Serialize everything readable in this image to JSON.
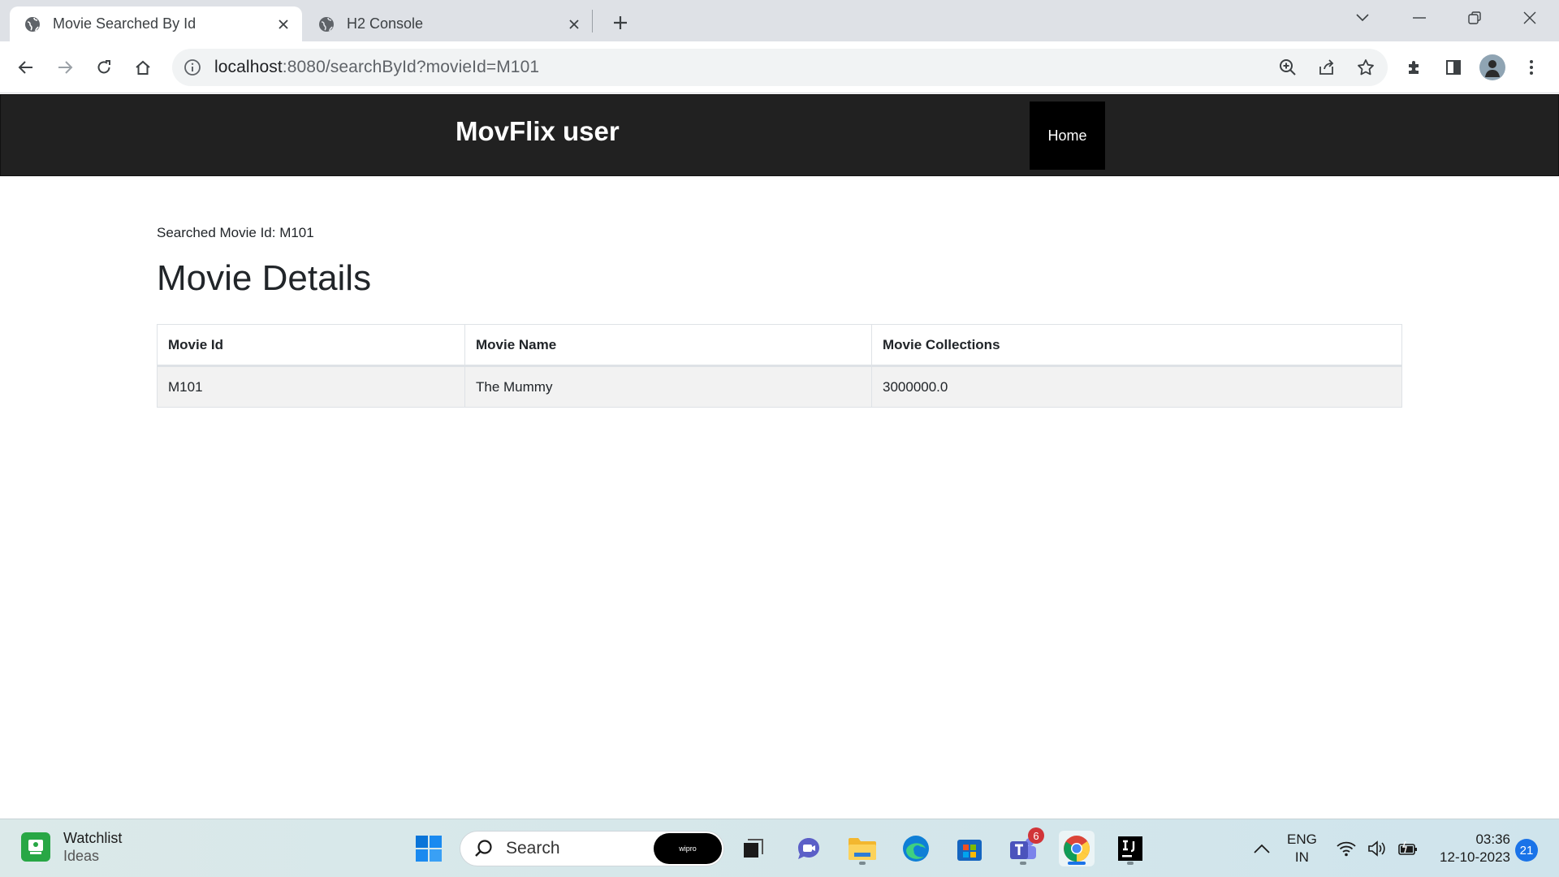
{
  "browser": {
    "tabs": [
      {
        "title": "Movie Searched By Id",
        "active": true
      },
      {
        "title": "H2 Console",
        "active": false
      }
    ],
    "url_host": "localhost",
    "url_rest": ":8080/searchById?movieId=M101"
  },
  "page": {
    "brand": "MovFlix user",
    "nav_home": "Home",
    "searched_label": "Searched Movie Id: M101",
    "heading": "Movie Details",
    "table": {
      "headers": [
        "Movie Id",
        "Movie Name",
        "Movie Collections"
      ],
      "rows": [
        [
          "M101",
          "The Mummy",
          "3000000.0"
        ]
      ]
    }
  },
  "taskbar": {
    "widget_title": "Watchlist",
    "widget_subtitle": "Ideas",
    "search_placeholder": "Search",
    "wipro_label": "wipro",
    "teams_badge": "6",
    "lang_top": "ENG",
    "lang_bottom": "IN",
    "time": "03:36",
    "date": "12-10-2023",
    "notification_count": "21"
  },
  "colors": {
    "navbar_bg": "#212121",
    "nav_active_bg": "#000000",
    "table_row_bg": "#f2f2f2",
    "accent": "#1a73e8"
  }
}
